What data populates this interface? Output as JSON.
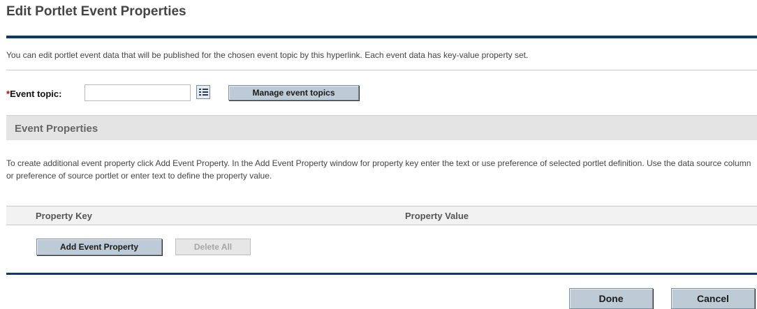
{
  "page": {
    "title": "Edit Portlet Event Properties",
    "intro": "You can edit portlet event data that will be published for the chosen event topic by this hyperlink. Each event data has key-value property set."
  },
  "event_topic": {
    "required_mark": "*",
    "label": "Event topic:",
    "value": "",
    "picker_icon": "list-picker-icon",
    "manage_button": "Manage event topics"
  },
  "event_properties": {
    "header": "Event Properties",
    "help": "To create additional event property click Add Event Property. In the Add Event Property window for property key enter the text or use preference of selected portlet definition. Use the data source column or preference of source portlet or enter text to define the property value.",
    "columns": [
      "Property Key",
      "Property Value"
    ],
    "add_button": "Add Event Property",
    "delete_button": "Delete All"
  },
  "footer": {
    "done_button": "Done",
    "cancel_button": "Cancel"
  },
  "colors": {
    "accent_rule": "#0a3a6b",
    "button_bg": "#bccbd5",
    "required": "#cc0000"
  }
}
